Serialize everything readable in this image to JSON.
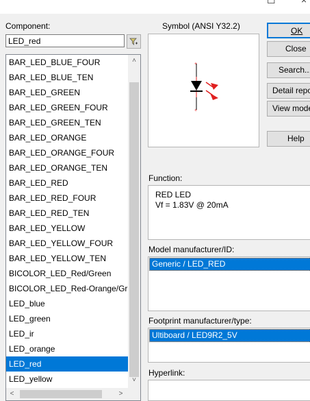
{
  "window": {
    "close_glyph": "×",
    "maximize_glyph": "☐"
  },
  "component": {
    "label": "Component:",
    "value": "LED_red",
    "filter_icon": "filter-icon",
    "items": [
      "BAR_LED_BLUE_FOUR",
      "BAR_LED_BLUE_TEN",
      "BAR_LED_GREEN",
      "BAR_LED_GREEN_FOUR",
      "BAR_LED_GREEN_TEN",
      "BAR_LED_ORANGE",
      "BAR_LED_ORANGE_FOUR",
      "BAR_LED_ORANGE_TEN",
      "BAR_LED_RED",
      "BAR_LED_RED_FOUR",
      "BAR_LED_RED_TEN",
      "BAR_LED_YELLOW",
      "BAR_LED_YELLOW_FOUR",
      "BAR_LED_YELLOW_TEN",
      "BICOLOR_LED_Red/Green",
      "BICOLOR_LED_Red-Orange/Gr",
      "LED_blue",
      "LED_green",
      "LED_ir",
      "LED_orange",
      "LED_red",
      "LED_yellow"
    ],
    "selected_index": 20
  },
  "symbol": {
    "label": "Symbol (ANSI Y32.2)",
    "icon": "led-symbol-icon"
  },
  "buttons": {
    "ok": "OK",
    "close": "Close",
    "search": "Search...",
    "detail_report": "Detail report",
    "view_model": "View model",
    "help": "Help"
  },
  "function": {
    "label": "Function:",
    "text": "RED LED\nVf = 1.83V @ 20mA"
  },
  "model": {
    "label": "Model manufacturer/ID:",
    "selected": "Generic / LED_RED"
  },
  "footprint": {
    "label": "Footprint manufacturer/type:",
    "selected": "Ultiboard / LED9R2_5V"
  },
  "hyperlink": {
    "label": "Hyperlink:"
  },
  "colors": {
    "selection": "#0078d7",
    "led_arrow": "#e02020"
  }
}
